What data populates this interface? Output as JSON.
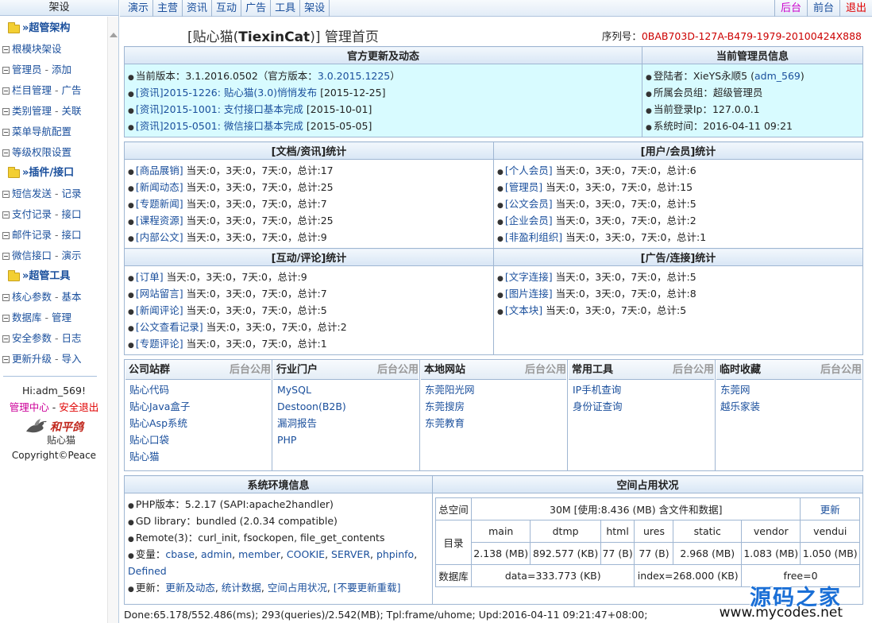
{
  "sidebar": {
    "header": "架设",
    "groups": [
      {
        "title": "超管架构",
        "items": [
          {
            "a": "根模块架设",
            "b": ""
          },
          {
            "a": "管理员",
            "b": "添加"
          },
          {
            "a": "栏目管理",
            "b": "广告"
          },
          {
            "a": "类别管理",
            "b": "关联"
          },
          {
            "a": "菜单导航配置",
            "b": ""
          },
          {
            "a": "等级权限设置",
            "b": ""
          }
        ]
      },
      {
        "title": "插件/接口",
        "items": [
          {
            "a": "短信发送",
            "b": "记录"
          },
          {
            "a": "支付记录",
            "b": "接口"
          },
          {
            "a": "邮件记录",
            "b": "接口"
          },
          {
            "a": "微信接口",
            "b": "演示"
          }
        ]
      },
      {
        "title": "超管工具",
        "items": [
          {
            "a": "核心参数",
            "b": "基本"
          },
          {
            "a": "数据库",
            "b": "管理"
          },
          {
            "a": "安全参数",
            "b": "日志"
          },
          {
            "a": "更新升级",
            "b": "导入"
          }
        ]
      }
    ],
    "greeting": "Hi:adm_569!",
    "member_center": "管理中心",
    "logout": "安全退出",
    "separator": "-",
    "logo_text": "和平鸽",
    "logo_sub": "贴心猫",
    "copyright": "Copyright©Peace"
  },
  "topnav": {
    "items": [
      "演示",
      "主营",
      "资讯",
      "互动",
      "广告",
      "工具",
      "架设"
    ],
    "back": "后台",
    "front": "前台",
    "quit": "退出"
  },
  "header": {
    "title_pre": "[贴心猫(",
    "title_brand": "TiexinCat",
    "title_post": ")] 管理首页",
    "serial_label": "序列号：",
    "serial_value": "0BAB703D-127A-B479-1979-20100424X888"
  },
  "updates": {
    "title": "官方更新及动态",
    "version_pre": "当前版本：3.1.2016.0502（官方版本：",
    "version_official": "3.0.2015.1225",
    "version_post": "）",
    "news": [
      {
        "link": "[资讯]2015-1226: 贴心猫(3.0)悄悄发布",
        "date": "[2015-12-25]"
      },
      {
        "link": "[资讯]2015-1001: 支付接口基本完成",
        "date": "[2015-10-01]"
      },
      {
        "link": "[资讯]2015-0501: 微信接口基本完成",
        "date": "[2015-05-05]"
      }
    ]
  },
  "admin_info": {
    "title": "当前管理员信息",
    "login_pre": "登陆者：XieYS永顺5 (",
    "login_id": "adm_569",
    "login_post": ")",
    "group": "所属会员组：超级管理员",
    "ip": "当前登录Ip：127.0.0.1",
    "time": "系统时间：2016-04-11 09:21"
  },
  "stats": {
    "docs": {
      "title": "[文档/资讯]统计",
      "rows": [
        {
          "name": "[商品展销]",
          "text": "当天:0，3天:0，7天:0，总计:17"
        },
        {
          "name": "[新闻动态]",
          "text": "当天:0，3天:0，7天:0，总计:25"
        },
        {
          "name": "[专题新闻]",
          "text": "当天:0，3天:0，7天:0，总计:7"
        },
        {
          "name": "[课程资源]",
          "text": "当天:0，3天:0，7天:0，总计:25"
        },
        {
          "name": "[内部公文]",
          "text": "当天:0，3天:0，7天:0，总计:9"
        }
      ]
    },
    "users": {
      "title": "[用户/会员]统计",
      "rows": [
        {
          "name": "[个人会员]",
          "text": "当天:0，3天:0，7天:0，总计:6"
        },
        {
          "name": "[管理员]",
          "text": "当天:0，3天:0，7天:0，总计:15"
        },
        {
          "name": "[公文会员]",
          "text": "当天:0，3天:0，7天:0，总计:5"
        },
        {
          "name": "[企业会员]",
          "text": "当天:0，3天:0，7天:0，总计:2"
        },
        {
          "name": "[非盈利组织]",
          "text": "当天:0，3天:0，7天:0，总计:1"
        }
      ]
    },
    "interact": {
      "title": "[互动/评论]统计",
      "rows": [
        {
          "name": "[订单]",
          "text": "当天:0，3天:0，7天:0，总计:9"
        },
        {
          "name": "[网站留言]",
          "text": "当天:0，3天:0，7天:0，总计:7"
        },
        {
          "name": "[新闻评论]",
          "text": "当天:0，3天:0，7天:0，总计:5"
        },
        {
          "name": "[公文查看记录]",
          "text": "当天:0，3天:0，7天:0，总计:2"
        },
        {
          "name": "[专题评论]",
          "text": "当天:0，3天:0，7天:0，总计:1"
        }
      ]
    },
    "ads": {
      "title": "[广告/连接]统计",
      "rows": [
        {
          "name": "[文字连接]",
          "text": "当天:0，3天:0，7天:0，总计:5"
        },
        {
          "name": "[图片连接]",
          "text": "当天:0，3天:0，7天:0，总计:8"
        },
        {
          "name": "[文本块]",
          "text": "当天:0，3天:0，7天:0，总计:5"
        }
      ]
    }
  },
  "public": {
    "tag": "后台公用",
    "cols": [
      {
        "title": "公司站群",
        "links": [
          "贴心代码",
          "贴心Java盒子",
          "贴心Asp系统",
          "贴心口袋",
          "贴心猫"
        ]
      },
      {
        "title": "行业门户",
        "links": [
          "MySQL",
          "Destoon(B2B)",
          "漏洞报告",
          "PHP"
        ]
      },
      {
        "title": "本地网站",
        "links": [
          "东莞阳光网",
          "东莞搜房",
          "东莞教育"
        ]
      },
      {
        "title": "常用工具",
        "links": [
          "IP手机查询",
          "身份证查询"
        ]
      },
      {
        "title": "临时收藏",
        "links": [
          "东莞网",
          "越乐家装"
        ]
      }
    ]
  },
  "env": {
    "title": "系统环境信息",
    "php": "PHP版本：5.2.17 (SAPI:apache2handler)",
    "gd": "GD library：bundled (2.0.34 compatible)",
    "remote": "Remote(3)：curl_init, fsockopen, file_get_contents",
    "vars_label": "变量：",
    "vars": [
      "cbase",
      "admin",
      "member",
      "COOKIE",
      "SERVER",
      "phpinfo"
    ],
    "vars_extra": "Defined",
    "update_label": "更新：",
    "update_links": [
      "更新及动态",
      "统计数据",
      "空间占用状况"
    ],
    "update_no": "[不要更新重载]"
  },
  "space": {
    "title": "空间占用状况",
    "total_label": "总空间",
    "total_value": "30M [使用:8.436 (MB) 含文件和数据]",
    "refresh": "更新",
    "dir_label": "目录",
    "dirs": [
      {
        "name": "main",
        "size": "2.138 (MB)"
      },
      {
        "name": "dtmp",
        "size": "892.577 (KB)"
      },
      {
        "name": "html",
        "size": "77 (B)"
      },
      {
        "name": "ures",
        "size": "77 (B)"
      },
      {
        "name": "static",
        "size": "2.968 (MB)"
      },
      {
        "name": "vendor",
        "size": "1.083 (MB)"
      },
      {
        "name": "vendui",
        "size": "1.050 (MB)"
      }
    ],
    "db_label": "数据库",
    "db_data": "data=333.773 (KB)",
    "db_index": "index=268.000 (KB)",
    "db_free": "free=0"
  },
  "footer": "Done:65.178/552.486(ms); 293(queries)/2.542(MB); Tpl:frame/uhome; Upd:2016-04-11 09:21:47+08:00;",
  "watermark": {
    "cn": "源码之家",
    "url": "www.mycodes.net"
  }
}
